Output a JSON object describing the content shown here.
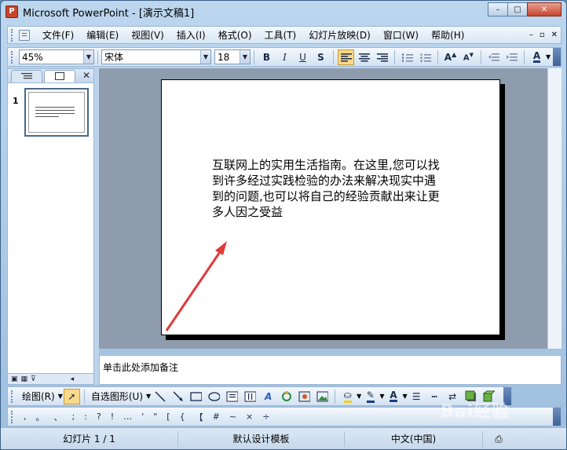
{
  "window": {
    "title": "Microsoft PowerPoint - [演示文稿1]",
    "app_icon_letter": "P",
    "controls": {
      "minimize": "–",
      "maximize": "□",
      "close": "✕"
    }
  },
  "menubar": {
    "items": [
      "文件(F)",
      "编辑(E)",
      "视图(V)",
      "插入(I)",
      "格式(O)",
      "工具(T)",
      "幻灯片放映(D)",
      "窗口(W)",
      "帮助(H)"
    ],
    "doc_controls": [
      "–",
      "▫",
      "✕"
    ]
  },
  "format_toolbar": {
    "zoom": "45%",
    "font_name": "宋体",
    "font_size": "18",
    "buttons": [
      "B",
      "I",
      "U",
      "S"
    ],
    "align_active": "align-left"
  },
  "left_pane": {
    "tabs": [
      "outline-tab",
      "slides-tab"
    ],
    "close": "✕",
    "slide_number": "1"
  },
  "slide": {
    "text": "互联网上的实用生活指南。在这里,您可以找到许多经过实践检验的办法来解决现实中遇到的问题,也可以将自己的经验贡献出来让更多人因之受益",
    "arrow_color": "#e03a3a"
  },
  "notes": {
    "placeholder": "单击此处添加备注"
  },
  "draw_toolbar": {
    "draw_menu": "绘图(R)",
    "autoshapes": "自选图形(U)"
  },
  "symbol_toolbar": {
    "symbols": [
      ",",
      "。",
      "、",
      ";",
      ":",
      "?",
      "!",
      "…",
      "'",
      "\"",
      "[",
      "{",
      "【",
      "#",
      "~",
      "×",
      "÷"
    ]
  },
  "statusbar": {
    "slide_info": "幻灯片 1 / 1",
    "template": "默认设计模板",
    "language": "中文(中国)"
  },
  "watermark": "Bai经验"
}
